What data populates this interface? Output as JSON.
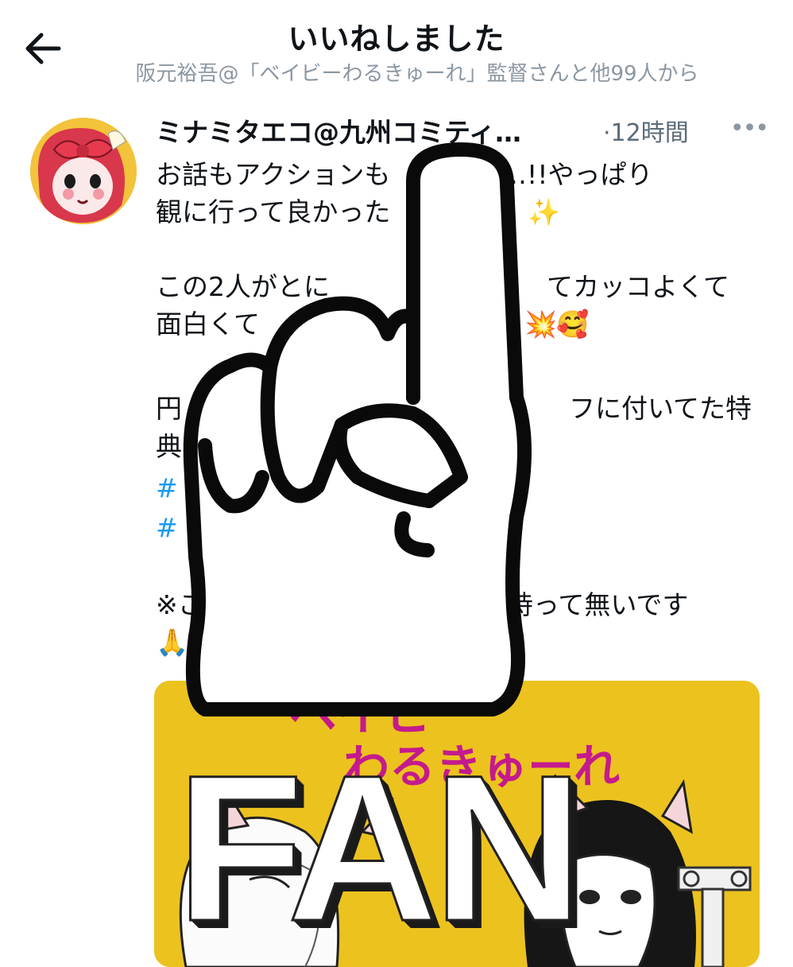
{
  "header": {
    "title": "いいねしました",
    "subtitle": "阪元裕吾@「ベイビーわるきゅーれ」監督さんと他99人から",
    "back_icon": "arrow-left-icon"
  },
  "tweet": {
    "author": "ミナミタエコ@九州コミティ…",
    "time": "·12時間",
    "more_icon": "more-horizontal-icon",
    "more_glyph": "•••",
    "lines": [
      "お話もアクションも",
      "った…!!やっぱり",
      "観に行って良かった",
      "この2人がとに",
      "てカッコよくて",
      "面白くて",
      "フに付いてた特",
      "※こ",
      "持って無いです"
    ],
    "hashtag_glyphs": [
      "#",
      "#"
    ],
    "fragments": [
      "円",
      "典"
    ],
    "emoji": {
      "sparkle": "✨",
      "explosion": "💥",
      "smiling_hearts": "🥰",
      "praying": "🙏"
    }
  },
  "media": {
    "title_line1": "ベイビー",
    "title_line2": "わるきゅーれ",
    "background": "#ecc21f",
    "title_color": "#c41a8c"
  },
  "overlay": {
    "word": "FAN",
    "hand_icon": "pointing-finger-up-icon"
  },
  "colors": {
    "text": "#0f1419",
    "secondary": "#8b97a2",
    "link": "#1d9bf0"
  }
}
